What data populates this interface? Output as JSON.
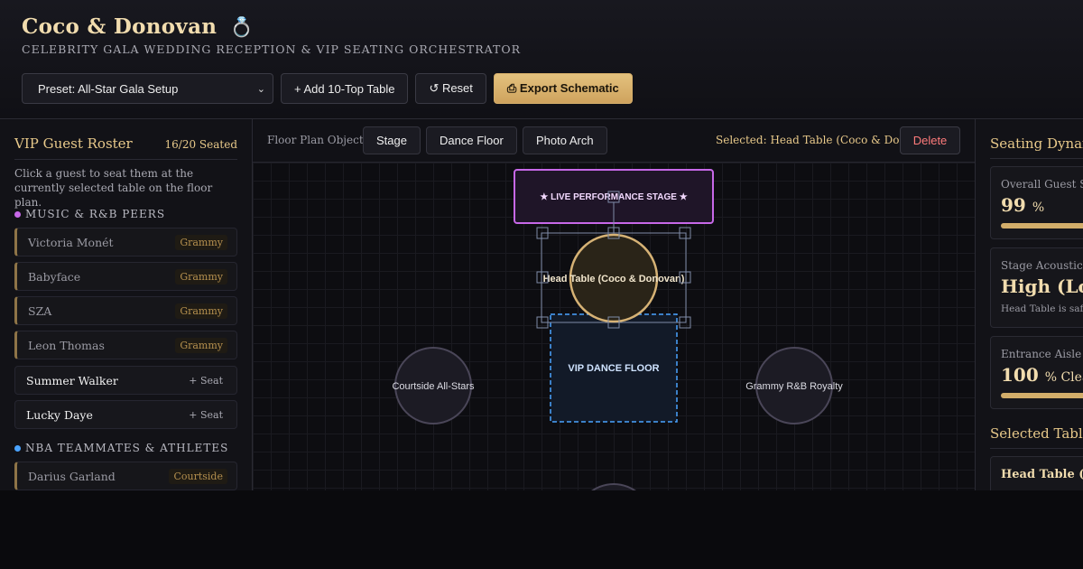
{
  "header": {
    "title": "Coco & Donovan",
    "title_icon": "ring-icon",
    "subtitle": "CELEBRITY GALA WEDDING RECEPTION & VIP SEATING ORCHESTRATOR"
  },
  "toolbar": {
    "preset_label": "Preset: All-Star Gala Setup",
    "add_table_label": "+ Add 10-Top Table",
    "reset_label": "↺ Reset",
    "export_label": "⎙ Export Schematic"
  },
  "roster": {
    "title": "VIP Guest Roster",
    "count": "16/20 Seated",
    "description": "Click a guest to seat them at the currently selected table on the floor plan.",
    "groups": [
      {
        "label": "MUSIC & R&B PEERS",
        "color": "#c768e8",
        "guests": [
          {
            "name": "Victoria Monét",
            "tag": "Grammy",
            "seated": true
          },
          {
            "name": "Babyface",
            "tag": "Grammy",
            "seated": true
          },
          {
            "name": "SZA",
            "tag": "Grammy",
            "seated": true
          },
          {
            "name": "Leon Thomas",
            "tag": "Grammy",
            "seated": true
          },
          {
            "name": "Summer Walker",
            "tag": "+ Seat",
            "seated": false
          },
          {
            "name": "Lucky Daye",
            "tag": "+ Seat",
            "seated": false
          }
        ]
      },
      {
        "label": "NBA TEAMMATES & ATHLETES",
        "color": "#4aa3ff",
        "guests": [
          {
            "name": "Darius Garland",
            "tag": "Courtside",
            "seated": true
          }
        ]
      }
    ]
  },
  "floor": {
    "objects_label": "Floor Plan Objects:",
    "buttons": [
      "Stage",
      "Dance Floor",
      "Photo Arch"
    ],
    "selected": "Selected: Head Table (Coco & Donovan)",
    "delete_label": "Delete",
    "stage_label": "★ LIVE PERFORMANCE STAGE ★",
    "dance_floor_label": "VIP DANCE FLOOR",
    "tables": {
      "head": "Head Table (Coco & Donovan)",
      "left": "Courtside All-Stars",
      "right": "Grammy R&B Royalty"
    }
  },
  "dynamics": {
    "title": "Seating Dynamics",
    "synergy": {
      "label": "Overall Guest Synergy",
      "value": "99",
      "unit": "%",
      "fraction": 0.99
    },
    "acoustic": {
      "label": "Stage Acoustic Proximity",
      "value": "High (Loud)",
      "note": "Head Table is safely distanced"
    },
    "sightline": {
      "label": "Entrance Aisle Sightline",
      "value": "100",
      "unit": "% Clear",
      "fraction": 1.0
    },
    "selected_title": "Selected Table Seats",
    "selected_table": "Head Table (Coco & Donovan)"
  },
  "colors": {
    "accent_gold": "#e8c98a",
    "stage_border": "#c768e8",
    "dance_floor_border": "#4aa3ff",
    "delete_red": "#ff7b7b"
  }
}
